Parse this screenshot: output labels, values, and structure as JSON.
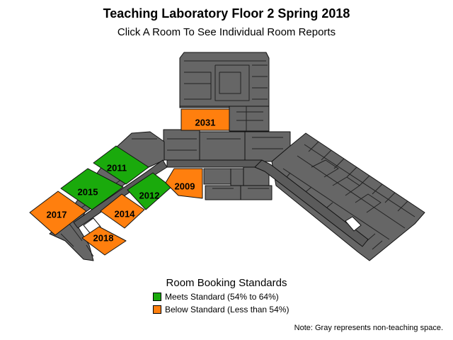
{
  "title": "Teaching Laboratory Floor 2 Spring 2018",
  "subtitle": "Click A Room To See Individual Room Reports",
  "colors": {
    "meets": "#1aaa0c",
    "below": "#ff7f0e",
    "gray": "#666666",
    "corridor": "#5b5b5b",
    "outline": "#111111"
  },
  "rooms": [
    {
      "id": "2031",
      "label": "2031",
      "status": "below"
    },
    {
      "id": "2011",
      "label": "2011",
      "status": "meets"
    },
    {
      "id": "2015",
      "label": "2015",
      "status": "meets"
    },
    {
      "id": "2012",
      "label": "2012",
      "status": "meets"
    },
    {
      "id": "2009",
      "label": "2009",
      "status": "below"
    },
    {
      "id": "2017",
      "label": "2017",
      "status": "below"
    },
    {
      "id": "2014",
      "label": "2014",
      "status": "below"
    },
    {
      "id": "2018",
      "label": "2018",
      "status": "below"
    }
  ],
  "legend": {
    "title": "Room Booking Standards",
    "items": [
      {
        "label": "Meets Standard (54% to 64%)",
        "status": "meets"
      },
      {
        "label": "Below Standard (Less than 54%)",
        "status": "below"
      }
    ]
  },
  "note": "Note: Gray represents non-teaching space."
}
